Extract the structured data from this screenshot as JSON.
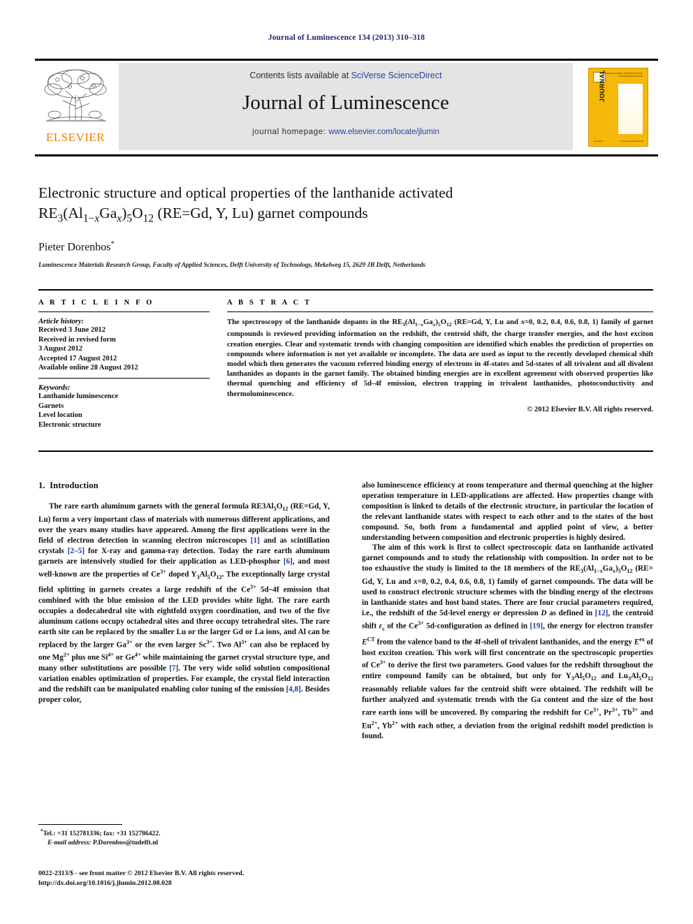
{
  "running_head": "Journal of Luminescence 134 (2013) 310–318",
  "masthead": {
    "contents_prefix": "Contents lists available at ",
    "sciencedirect_link": "SciVerse ScienceDirect",
    "journal_title": "Journal of Luminescence",
    "homepage_prefix": "journal homepage: ",
    "homepage_link": "www.elsevier.com/locate/jlumin",
    "publisher_logo_text": "ELSEVIER",
    "cover_title": "JOURNAL OF LUMINESCENCE",
    "cover_subtitle": "INTERNATIONAL JOURNAL OF RESEARCH ON THE FUNDAMENTAL PROCESSES",
    "cover_footer_left": "ScienceDirect",
    "cover_footer_right": "www.elsevier.com/locate/jlumin"
  },
  "title": {
    "line1": "Electronic structure and optical properties of the lanthanide activated",
    "line2_pre": "RE",
    "line2_sub1": "3",
    "line2_a": "(Al",
    "line2_sub2": "1−x",
    "line2_b": "Ga",
    "line2_sub3": "x",
    "line2_c": ")",
    "line2_sub4": "5",
    "line2_d": "O",
    "line2_sub5": "12",
    "line2_tail": " (RE=Gd, Y, Lu) garnet compounds"
  },
  "author": {
    "name": "Pieter Dorenbos",
    "marker": "*"
  },
  "affiliation": "Luminescence Materials Research Group, Faculty of Applied Sciences, Delft University of Technology, Mekelweg 15, 2629 JB Delft, Netherlands",
  "article_info": {
    "heading": "A R T I C L E   I N F O",
    "history_label": "Article history:",
    "history": [
      "Received 3 June 2012",
      "Received in revised form",
      "3 August 2012",
      "Accepted 17 August 2012",
      "Available online 28 August 2012"
    ],
    "keywords_label": "Keywords:",
    "keywords": [
      "Lanthanide luminescence",
      "Garnets",
      "Level location",
      "Electronic structure"
    ]
  },
  "abstract": {
    "heading": "A B S T R A C T",
    "text": "The spectroscopy of the lanthanide dopants in the RE3(Al1−xGax)5O12 (RE=Gd, Y, Lu and x=0, 0.2, 0.4, 0.6, 0.8, 1) family of garnet compounds is reviewed providing information on the redshift, the centroid shift, the charge transfer energies, and the host exciton creation energies. Clear and systematic trends with changing composition are identified which enables the prediction of properties on compounds where information is not yet available or incomplete. The data are used as input to the recently developed chemical shift model which then generates the vacuum referred binding energy of electrons in 4f-states and 5d-states of all trivalent and all divalent lanthanides as dopants in the garnet family. The obtained binding energies are in excellent agreement with observed properties like thermal quenching and efficiency of 5d–4f emission, electron trapping in trivalent lanthanides, photoconductivity and thermoluminescence.",
    "copyright": "© 2012 Elsevier B.V. All rights reserved."
  },
  "body": {
    "section_number": "1.",
    "section_title": "Introduction",
    "left_paragraph_1": "The rare earth aluminum garnets with the general formula RE3Al5O12 (RE=Gd, Y, Lu) form a very important class of materials with numerous different applications, and over the years many studies have appeared. Among the first applications were in the field of electron detection in scanning electron microscopes [1] and as scintillation crystals [2–5] for X-ray and gamma-ray detection. Today the rare earth aluminum garnets are intensively studied for their application as LED-phosphor [6], and most well-known are the properties of Ce3+ doped Y3Al5O12. The exceptionally large crystal field splitting in garnets creates a large redshift of the Ce3+ 5d–4f emission that combined with the blue emission of the LED provides white light. The rare earth occupies a dodecahedral site with eightfold oxygen coordination, and two of the five aluminum cations occupy octahedral sites and three occupy tetrahedral sites. The rare earth site can be replaced by the smaller Lu or the larger Gd or La ions, and Al can be replaced by the larger Ga3+ or the even larger Sc3+. Two Al3+ can also be replaced by one Mg2+ plus one Si4+ or Ge4+ while maintaining the garnet crystal structure type, and many other substitutions are possible [7]. The very wide solid solution compositional variation enables optimization of properties. For example, the crystal field interaction and the redshift can be manipulated enabling color tuning of the emission [4,8]. Besides proper color,",
    "right_paragraph_1": "also luminescence efficiency at room temperature and thermal quenching at the higher operation temperature in LED-applications are affected. How properties change with composition is linked to details of the electronic structure, in particular the location of the relevant lanthanide states with respect to each other and to the states of the host compound. So, both from a fundamental and applied point of view, a better understanding between composition and electronic properties is highly desired.",
    "right_paragraph_2": "The aim of this work is first to collect spectroscopic data on lanthanide activated garnet compounds and to study the relationship with composition. In order not to be too exhaustive the study is limited to the 18 members of the RE3(Al1−xGax)5O12 (RE= Gd, Y, Lu and x=0, 0.2, 0.4, 0.6, 0.8, 1) family of garnet compounds. The data will be used to construct electronic structure schemes with the binding energy of the electrons in lanthanide states and host band states. There are four crucial parameters required, i.e., the redshift of the 5d-level energy or depression D as defined in [12], the centroid shift εc of the Ce3+ 5d-configuration as defined in [19], the energy for electron transfer ECT from the valence band to the 4f-shell of trivalent lanthanides, and the energy Eex of host exciton creation. This work will first concentrate on the spectroscopic properties of Ce3+ to derive the first two parameters. Good values for the redshift throughout the entire compound family can be obtained, but only for Y3Al5O12 and Lu3Al5O12 reasonably reliable values for the centroid shift were obtained. The redshift will be further analyzed and systematic trends with the Ga content and the size of the host rare earth ions will be uncovered. By comparing the redshift for Ce3+, Pr3+, Tb3+ and Eu2+, Yb2+ with each other, a deviation from the original redshift model prediction is found."
  },
  "footnote": {
    "marker": "*",
    "tel_line": "Tel.: +31 152781336; fax: +31 152786422.",
    "email_label": "E-mail address:",
    "email": "P.Dorenbos@tudelft.nl"
  },
  "imprint": {
    "line1": "0022-2313/$ - see front matter © 2012 Elsevier B.V. All rights reserved.",
    "line2": "http://dx.doi.org/10.1016/j.jlumin.2012.08.028"
  },
  "colors": {
    "link": "#2a3f9d",
    "reference": "#1c3a93",
    "running_head": "#1a2a6c",
    "elsevier_orange": "#f08000",
    "cover_yellow": "#f5b80a",
    "masthead_grey": "#e4e4e4"
  }
}
